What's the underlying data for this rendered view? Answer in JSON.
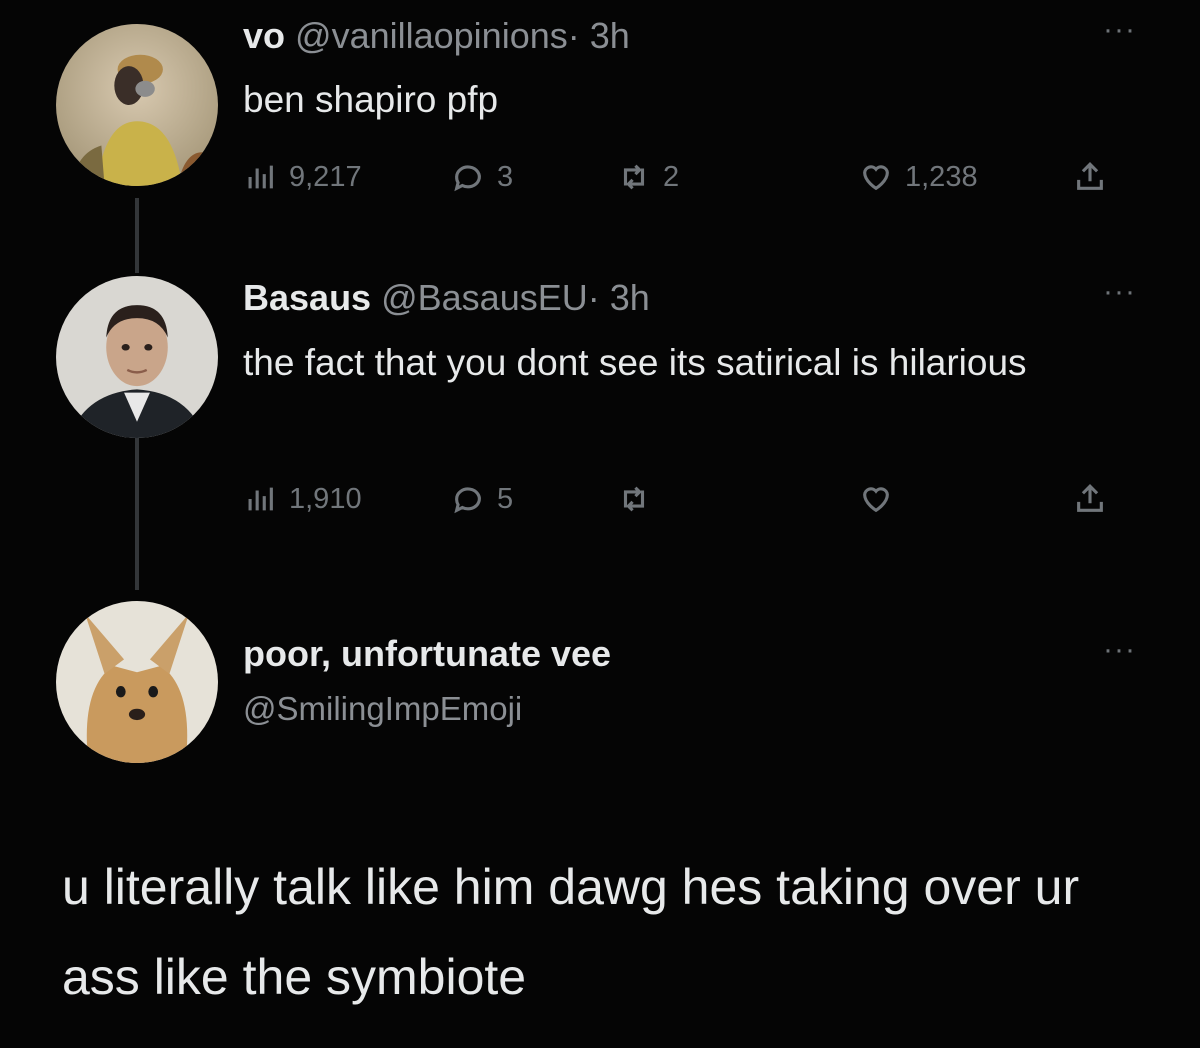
{
  "tweets": [
    {
      "display_name": "vo",
      "handle": "@vanillaopinions",
      "time": "· 3h",
      "text": "ben shapiro pfp",
      "views": "9,217",
      "replies": "3",
      "retweets": "2",
      "likes": "1,238"
    },
    {
      "display_name": "Basaus",
      "handle": "@BasausEU",
      "time": "· 3h",
      "text": "the fact that you dont see its satirical is hilarious",
      "views": "1,910",
      "replies": "5",
      "retweets": "",
      "likes": ""
    }
  ],
  "reply": {
    "display_name": "poor, unfortunate vee",
    "handle": "@SmilingImpEmoji",
    "text": "u literally talk like him dawg hes taking over ur ass like the symbiote"
  },
  "icons": {
    "views": "bar-chart-icon",
    "reply": "speech-bubble-icon",
    "retweet": "retweet-icon",
    "like": "heart-icon",
    "share": "share-icon",
    "more": "more-dots-icon"
  },
  "colors": {
    "background": "#050505",
    "text": "#e7e9ea",
    "muted": "#71767b"
  }
}
